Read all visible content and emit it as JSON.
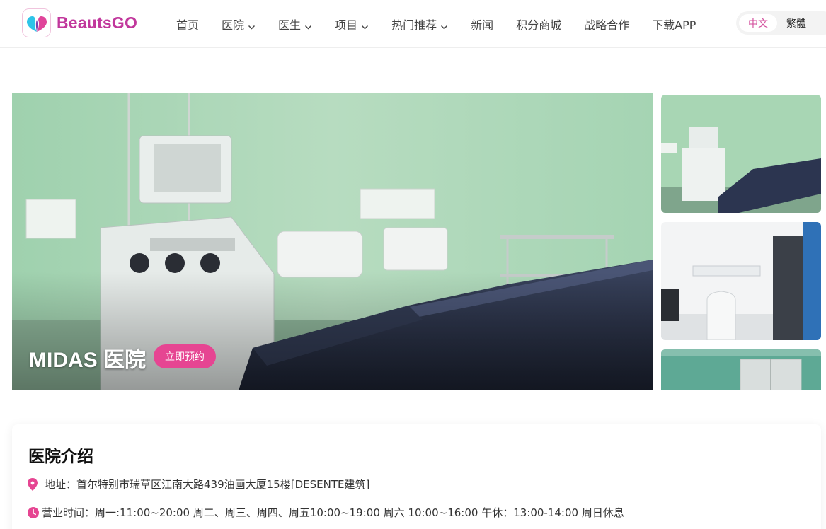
{
  "header": {
    "logo_text": "BeautsGO",
    "nav": [
      {
        "label": "首页",
        "dropdown": false
      },
      {
        "label": "医院",
        "dropdown": true
      },
      {
        "label": "医生",
        "dropdown": true
      },
      {
        "label": "项目",
        "dropdown": true
      },
      {
        "label": "热门推荐",
        "dropdown": true
      },
      {
        "label": "新闻",
        "dropdown": false
      },
      {
        "label": "积分商城",
        "dropdown": false
      },
      {
        "label": "战略合作",
        "dropdown": false
      },
      {
        "label": "下载APP",
        "dropdown": false
      }
    ],
    "lang": {
      "simplified": "中文",
      "traditional": "繁體",
      "active": "simplified"
    }
  },
  "hero": {
    "hospital_name": "MIDAS 医院",
    "book_button": "立即预约",
    "main_photo_icon": "operating-room-photo",
    "thumbnails": [
      "operating-room-photo",
      "equipment-room-photo",
      "corridor-photo"
    ]
  },
  "info": {
    "title": "医院介绍",
    "address": "地址：首尔特别市瑞草区江南大路439油画大厦15楼[DESENTE建筑]",
    "hours": "营业时间：周一:11:00~20:00 周二、周三、周四、周五10:00~19:00 周六 10:00~16:00 午休：13:00-14:00 周日休息"
  },
  "colors": {
    "brand": "#c1379c",
    "accent": "#e64592",
    "lang_active": "#d24a9a"
  }
}
